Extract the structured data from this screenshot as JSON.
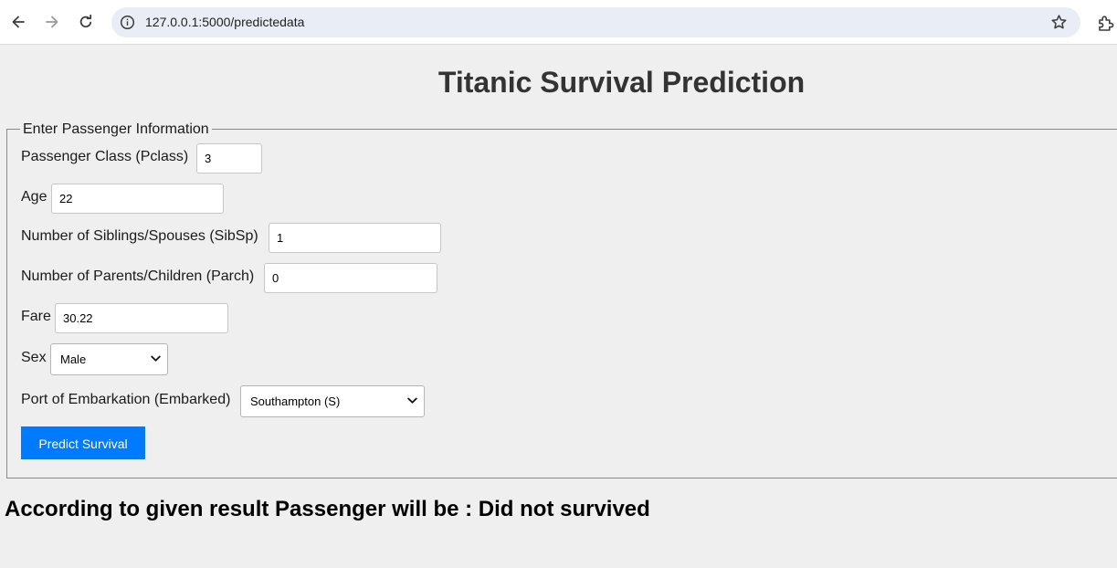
{
  "browser": {
    "url": "127.0.0.1:5000/predictedata"
  },
  "page": {
    "title": "Titanic Survival Prediction",
    "legend": "Enter Passenger Information",
    "fields": {
      "pclass": {
        "label": "Passenger Class (Pclass)",
        "value": "3"
      },
      "age": {
        "label": "Age",
        "value": "22"
      },
      "sibsp": {
        "label": "Number of Siblings/Spouses (SibSp)",
        "value": "1"
      },
      "parch": {
        "label": "Number of Parents/Children (Parch)",
        "value": "0"
      },
      "fare": {
        "label": "Fare",
        "value": "30.22"
      },
      "sex": {
        "label": "Sex",
        "value": "Male"
      },
      "embarked": {
        "label": "Port of Embarkation (Embarked)",
        "value": "Southampton (S)"
      }
    },
    "submit_label": "Predict Survival",
    "result": "According to given result Passenger will be : Did not survived"
  },
  "colors": {
    "button": "#007bff",
    "page_background": "#efefef",
    "title": "#333333"
  },
  "icons": [
    "back-arrow-icon",
    "forward-arrow-icon",
    "reload-icon",
    "site-info-icon",
    "bookmark-star-icon",
    "extensions-icon",
    "chevron-down-icon"
  ]
}
